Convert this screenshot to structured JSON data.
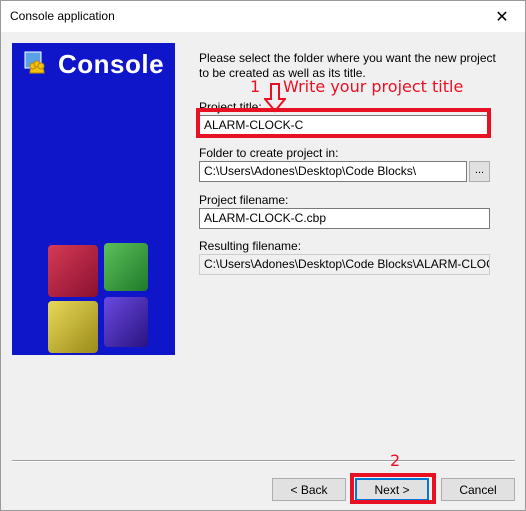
{
  "window": {
    "title": "Console application",
    "close_glyph": "✕"
  },
  "banner": {
    "title": "Console",
    "logo_icon": "code-blocks-logo-icon"
  },
  "intro_text": "Please select the folder where you want the new project to be created as well as its title.",
  "fields": {
    "project_title": {
      "label": "Project title:",
      "value": "ALARM-CLOCK-C"
    },
    "folder": {
      "label": "Folder to create project in:",
      "value": "C:\\Users\\Adones\\Desktop\\Code Blocks\\",
      "browse_label": "..."
    },
    "filename": {
      "label": "Project filename:",
      "value": "ALARM-CLOCK-C.cbp"
    },
    "resulting": {
      "label": "Resulting filename:",
      "value": "C:\\Users\\Adones\\Desktop\\Code Blocks\\ALARM-CLOC"
    }
  },
  "buttons": {
    "back": "< Back",
    "next": "Next >",
    "cancel": "Cancel"
  },
  "annotations": {
    "step1_number": "1",
    "step1_text": "Write your project title",
    "step2_number": "2",
    "color": "#e81123"
  },
  "colors": {
    "banner_bg": "#0f16c9",
    "dialog_bg": "#f0f0f0"
  }
}
